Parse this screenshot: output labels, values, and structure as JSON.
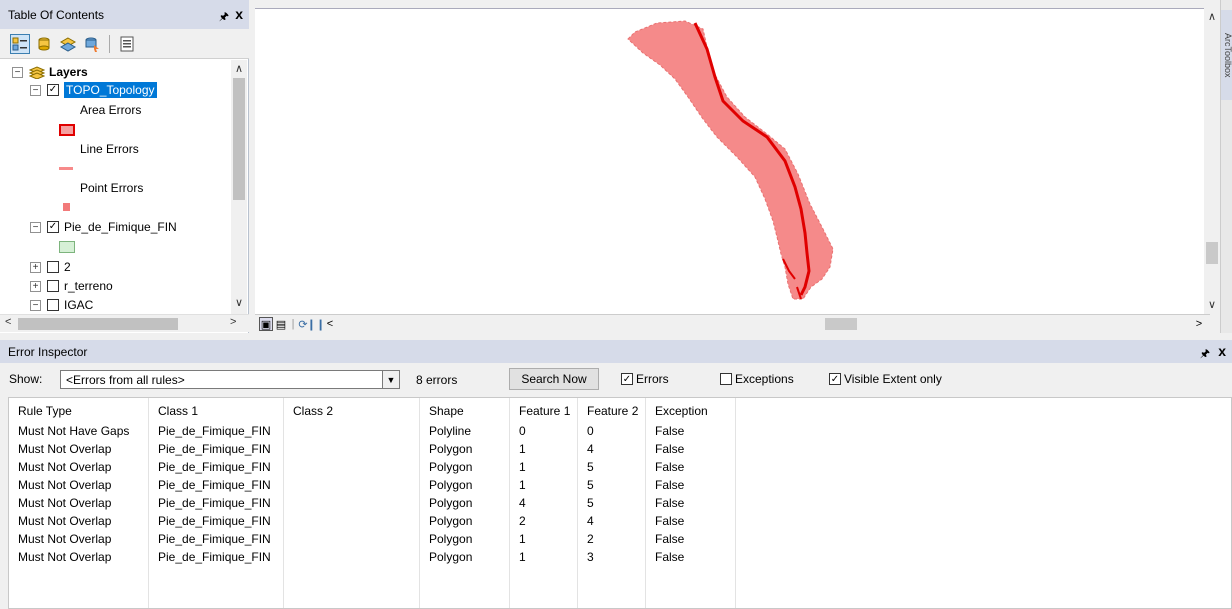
{
  "toc": {
    "title": "Table Of Contents",
    "pin_icon": "pin-icon",
    "close": "x",
    "tree": {
      "root": "Layers",
      "layers": [
        {
          "name": "TOPO_Topology",
          "checked": true,
          "expanded": true,
          "selected": true
        },
        {
          "name": "Pie_de_Fimique_FIN",
          "checked": true,
          "expanded": true
        },
        {
          "name": "2",
          "checked": false,
          "expanded": false
        },
        {
          "name": "r_terreno",
          "checked": false,
          "expanded": false
        },
        {
          "name": "IGAC",
          "checked": false,
          "expanded": true
        }
      ],
      "topology_legend": [
        "Area Errors",
        "Line Errors",
        "Point Errors"
      ]
    }
  },
  "map": {
    "bottom_controls": [
      "layout-view-icon",
      "data-view-icon",
      "refresh-icon",
      "pause-icon",
      "scroll-left-icon"
    ]
  },
  "right_dock": {
    "tab_label": "ArcToolbox"
  },
  "inspector": {
    "title": "Error Inspector",
    "show_label": "Show:",
    "show_value": "<Errors from all rules>",
    "count": "8 errors",
    "search_button": "Search Now",
    "errors_label": "Errors",
    "errors_checked": true,
    "exceptions_label": "Exceptions",
    "exceptions_checked": false,
    "visible_label": "Visible Extent only",
    "visible_checked": true,
    "columns": [
      "Rule Type",
      "Class 1",
      "Class 2",
      "Shape",
      "Feature 1",
      "Feature 2",
      "Exception"
    ],
    "rows": [
      [
        "Must Not Have Gaps",
        "Pie_de_Fimique_FIN",
        "",
        "Polyline",
        "0",
        "0",
        "False"
      ],
      [
        "Must Not Overlap",
        "Pie_de_Fimique_FIN",
        "",
        "Polygon",
        "1",
        "4",
        "False"
      ],
      [
        "Must Not Overlap",
        "Pie_de_Fimique_FIN",
        "",
        "Polygon",
        "1",
        "5",
        "False"
      ],
      [
        "Must Not Overlap",
        "Pie_de_Fimique_FIN",
        "",
        "Polygon",
        "1",
        "5",
        "False"
      ],
      [
        "Must Not Overlap",
        "Pie_de_Fimique_FIN",
        "",
        "Polygon",
        "4",
        "5",
        "False"
      ],
      [
        "Must Not Overlap",
        "Pie_de_Fimique_FIN",
        "",
        "Polygon",
        "2",
        "4",
        "False"
      ],
      [
        "Must Not Overlap",
        "Pie_de_Fimique_FIN",
        "",
        "Polygon",
        "1",
        "2",
        "False"
      ],
      [
        "Must Not Overlap",
        "Pie_de_Fimique_FIN",
        "",
        "Polygon",
        "1",
        "3",
        "False"
      ]
    ]
  },
  "colors": {
    "error_fill": "#f58a8a",
    "error_line": "#e00000",
    "title_bar": "#d6dbe9",
    "selection": "#0078d7"
  }
}
